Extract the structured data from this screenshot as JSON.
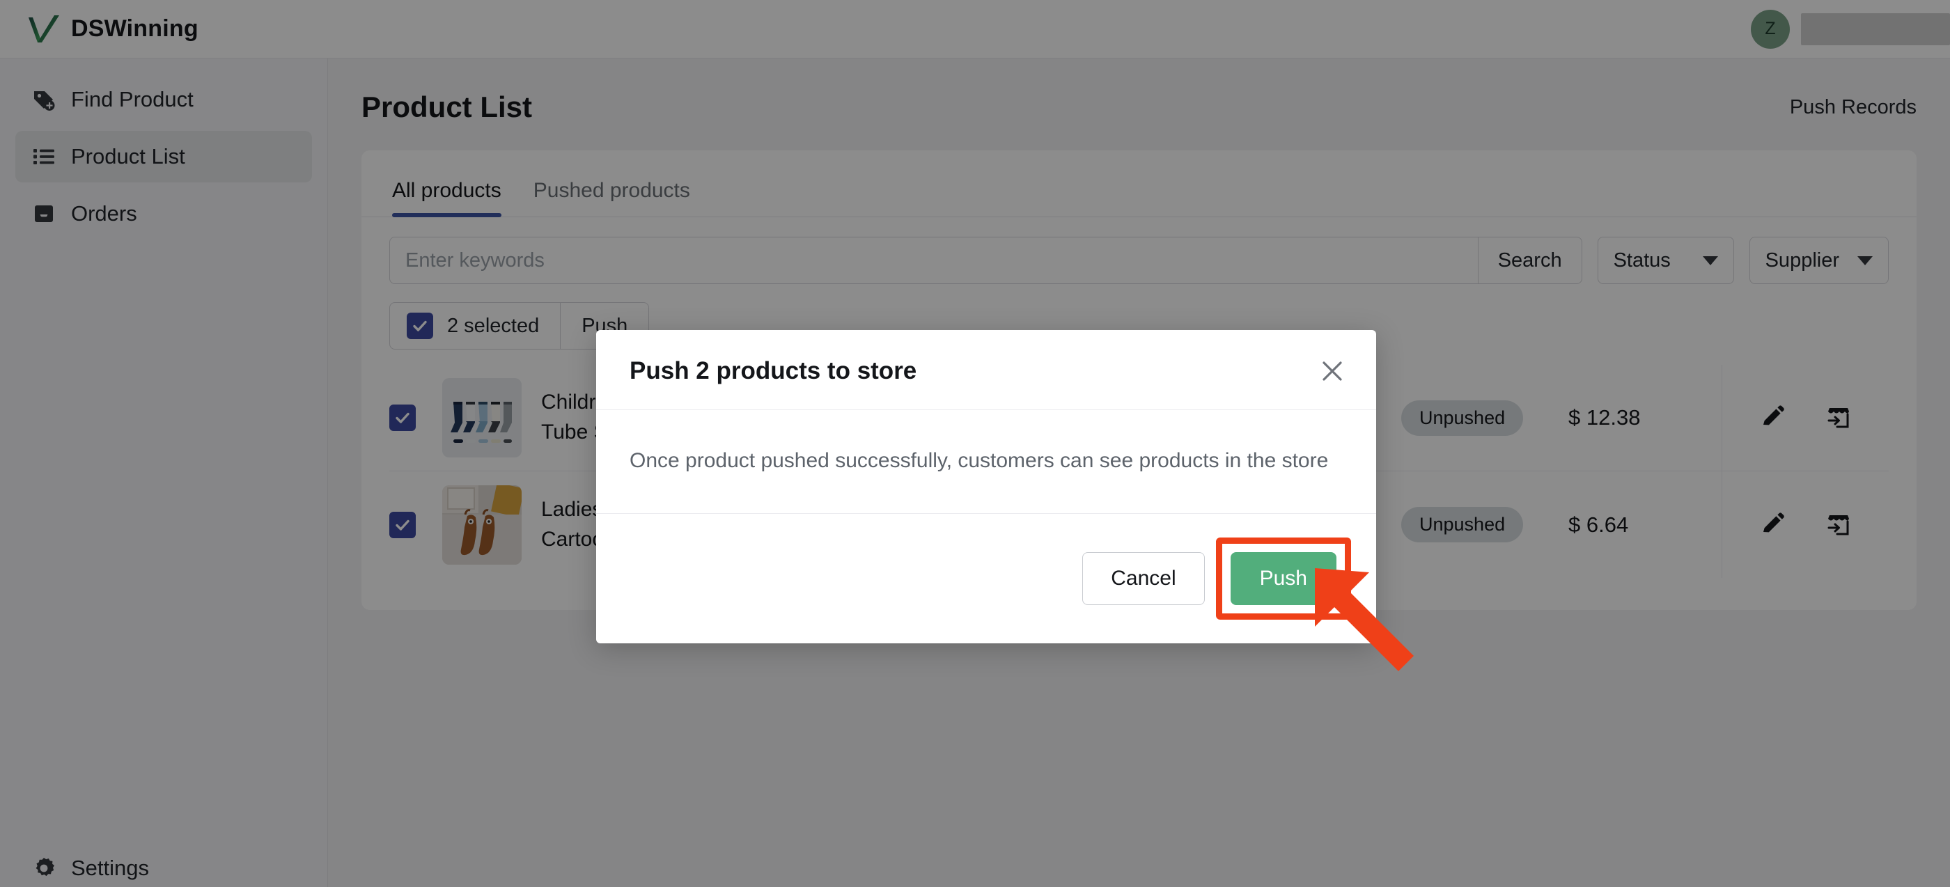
{
  "brand": {
    "name": "DSWinning",
    "logo_icon": "green-check-logo"
  },
  "topbar": {
    "avatar_initial": "Z",
    "avatar_color": "#7aa188",
    "username_redacted": true
  },
  "sidebar": {
    "items": [
      {
        "label": "Find Product",
        "icon": "tag-plus-icon",
        "active": false
      },
      {
        "label": "Product List",
        "icon": "list-icon",
        "active": true
      },
      {
        "label": "Orders",
        "icon": "inbox-icon",
        "active": false
      },
      {
        "label": "Settings",
        "icon": "gear-icon",
        "active": false
      }
    ]
  },
  "page": {
    "title": "Product List",
    "push_records_label": "Push Records"
  },
  "tabs": [
    {
      "label": "All products",
      "active": true
    },
    {
      "label": "Pushed products",
      "active": false
    }
  ],
  "filters": {
    "search_placeholder": "Enter keywords",
    "search_value": "",
    "search_button_label": "Search",
    "status_label": "Status",
    "supplier_label": "Supplier"
  },
  "bulk": {
    "selected_label": "2 selected",
    "selected_count": 2,
    "push_label": "Push"
  },
  "table": {
    "rows": [
      {
        "checked": true,
        "thumb": "kids-socks-photo",
        "name_line1": "Childre",
        "name_line2": "Tube S",
        "type": "shipping",
        "payment_icon": "card-icon",
        "status": "Unpushed",
        "price": "$ 12.38",
        "actions": [
          "edit-pencil-icon",
          "push-to-store-icon"
        ]
      },
      {
        "checked": true,
        "thumb": "ladies-cartoon-socks-photo",
        "name_line1": "Ladies",
        "name_line2": "Cartoon Socks",
        "type": "shipping",
        "payment_icon": "card-icon",
        "status": "Unpushed",
        "price": "$ 6.64",
        "actions": [
          "edit-pencil-icon",
          "push-to-store-icon"
        ]
      }
    ]
  },
  "modal": {
    "title": "Push 2 products to store",
    "message": "Once product pushed successfully, customers can see products in the store",
    "cancel_label": "Cancel",
    "push_label": "Push",
    "close_icon": "close-icon",
    "push_color": "#52ae7c",
    "highlight_color": "#ef4018"
  },
  "annotation": {
    "arrow_color": "#ef4018",
    "points_to": "push-button"
  }
}
